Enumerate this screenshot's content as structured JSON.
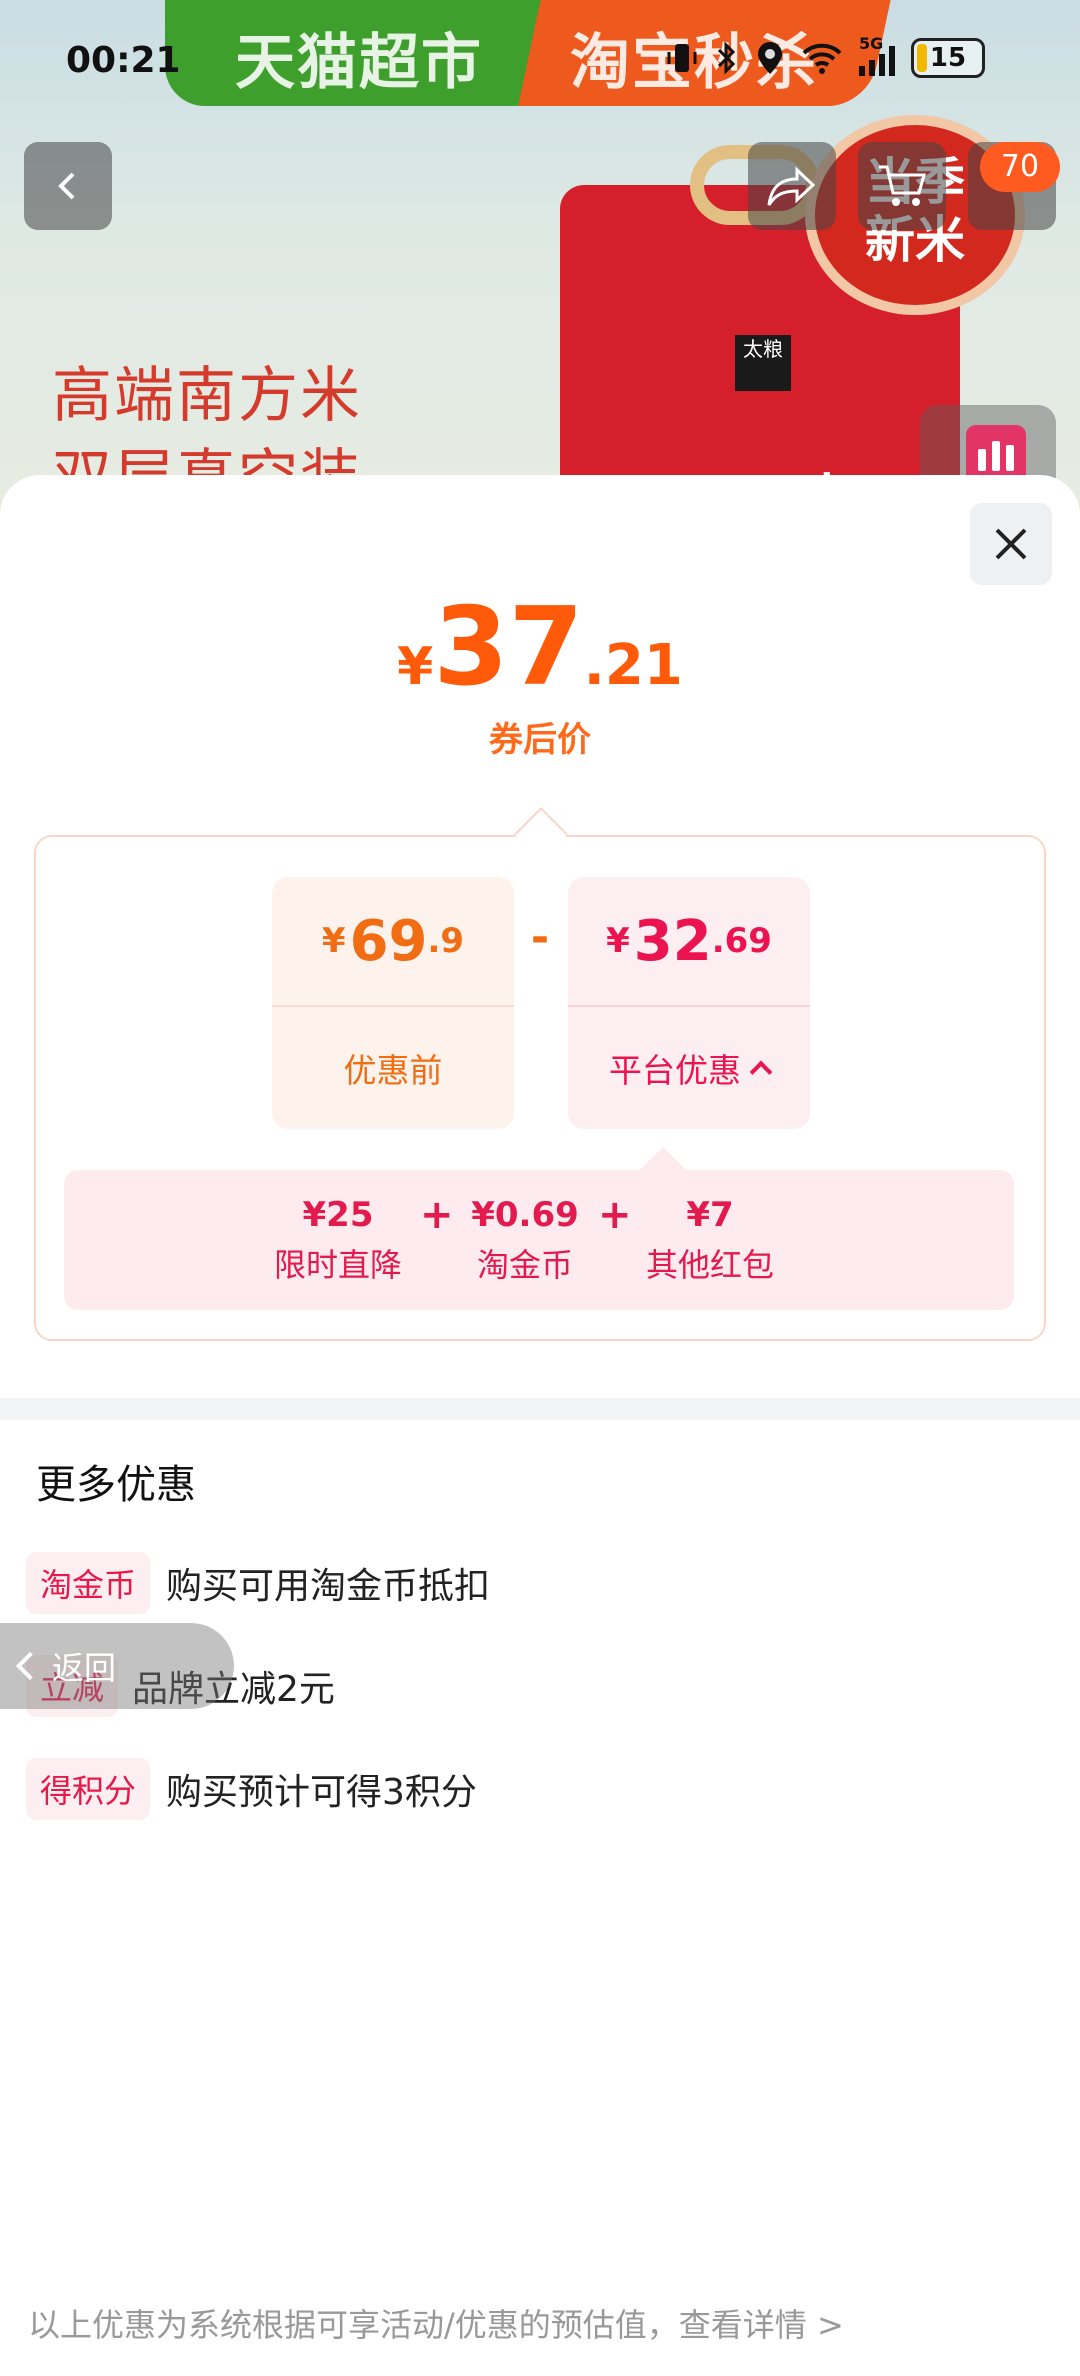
{
  "status_bar": {
    "time": "00:21",
    "battery_level": "15",
    "network_label": "5G"
  },
  "background_page": {
    "banner_left": "天猫超市",
    "banner_right": "淘宝秒杀",
    "headline_line1": "高端南方米",
    "headline_line2": "双层真空装",
    "badge_text_line1": "当季",
    "badge_text_line2": "新米",
    "brand_mark": "太粮",
    "bag_text": "靓",
    "cart_count": "70"
  },
  "price_detail": {
    "final_price": {
      "currency": "¥",
      "integer": "37",
      "decimal": ".21"
    },
    "final_price_label": "券后价",
    "original": {
      "currency": "¥",
      "integer": "69",
      "decimal": ".9",
      "label": "优惠前"
    },
    "operator": "-",
    "discount": {
      "currency": "¥",
      "integer": "32",
      "decimal": ".69",
      "label": "平台优惠"
    },
    "breakdown": [
      {
        "amount": "¥25",
        "name": "限时直降"
      },
      {
        "amount": "¥0.69",
        "name": "淘金币"
      },
      {
        "amount": "¥7",
        "name": "其他红包"
      }
    ],
    "plus_sign": "+"
  },
  "more_offers": {
    "title": "更多优惠",
    "items": [
      {
        "tag": "淘金币",
        "text": "购买可用淘金币抵扣"
      },
      {
        "tag": "立减",
        "text": "品牌立减2元"
      },
      {
        "tag": "得积分",
        "text": "购买预计可得3积分"
      }
    ]
  },
  "back_pill": {
    "label": "返回"
  },
  "footer_note": "以上优惠为系统根据可享活动/优惠的预估值，查看详情 >",
  "colors": {
    "price_orange": "#ff5a0a",
    "discount_red": "#ec1450",
    "tag_bg": "#fdeef1"
  }
}
